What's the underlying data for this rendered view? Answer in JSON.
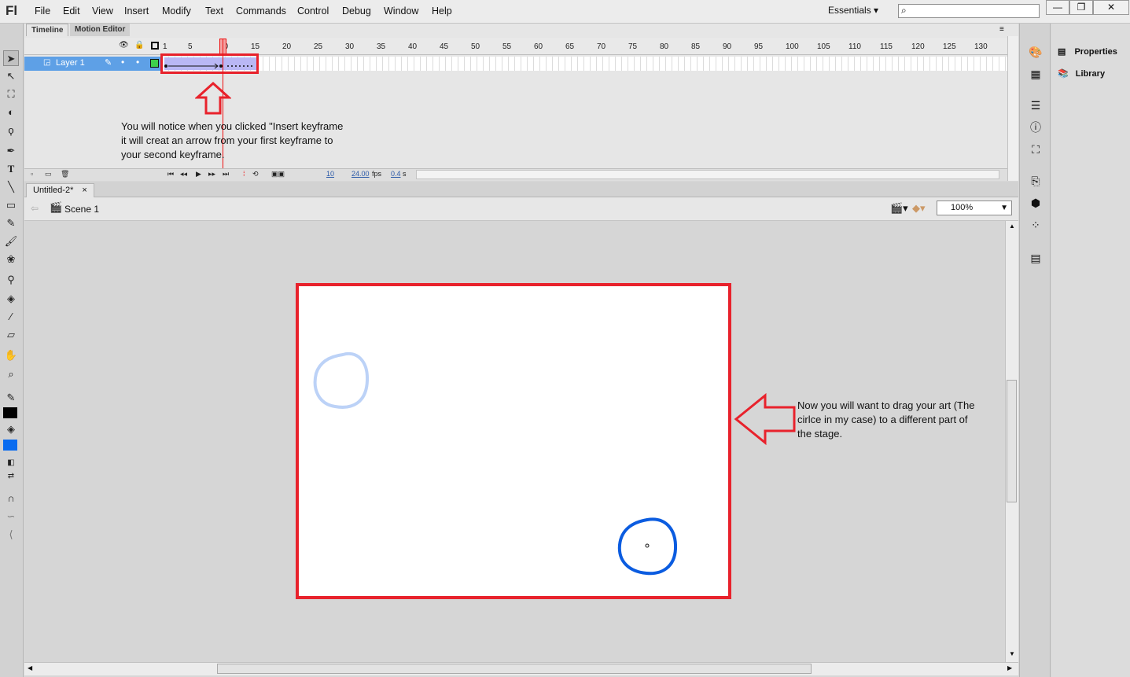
{
  "app": {
    "logo": "Fl"
  },
  "menu": [
    "File",
    "Edit",
    "View",
    "Insert",
    "Modify",
    "Text",
    "Commands",
    "Control",
    "Debug",
    "Window",
    "Help"
  ],
  "workspace": {
    "label": "Essentials",
    "search_placeholder": ""
  },
  "window_buttons": {
    "minimize": "—",
    "restore": "❐",
    "close": "✕"
  },
  "timeline": {
    "tabs": [
      "Timeline",
      "Motion Editor"
    ],
    "frame_numbers": [
      "1",
      "5",
      "10",
      "15",
      "20",
      "25",
      "30",
      "35",
      "40",
      "45",
      "50",
      "55",
      "60",
      "65",
      "70",
      "75",
      "80",
      "85",
      "90",
      "95",
      "100",
      "105",
      "110",
      "115",
      "120",
      "125",
      "130"
    ],
    "layer": {
      "name": "Layer 1"
    },
    "footer": {
      "current_frame": "10",
      "fps": "24.00",
      "fps_unit": "fps",
      "time": "0.4",
      "time_unit": "s"
    }
  },
  "document": {
    "tab": "Untitled-2*",
    "close": "×",
    "scene": "Scene 1",
    "zoom": "100%"
  },
  "annotations": {
    "timeline_note": [
      "You will notice when you clicked \"Insert keyframe",
      "it will creat an arrow from your first keyframe to",
      "your second keyframe."
    ],
    "stage_note": [
      "Now you will want to drag your art (The",
      "cirlce  in my case) to a different part of",
      "the stage."
    ]
  },
  "panels": {
    "properties": "Properties",
    "library": "Library"
  },
  "colors": {
    "accent_red": "#e8222c",
    "stroke_blue": "#0b5ce0",
    "onion_blue": "#bcd2f7",
    "fill_swatch": "#0a6cf0"
  }
}
